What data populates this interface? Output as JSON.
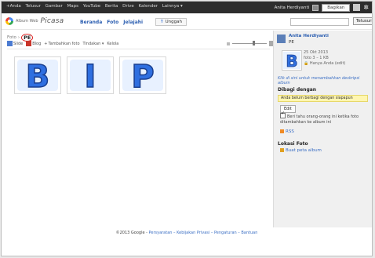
{
  "topbar": {
    "links": [
      "+Anda",
      "Telusur",
      "Gambar",
      "Maps",
      "YouTube",
      "Berita",
      "Drive",
      "Kalender",
      "Lainnya ▾"
    ],
    "user": "Anita Herdiyanti",
    "share_label": "Bagikan"
  },
  "header": {
    "logo_albums": "Album Web",
    "logo_picasa": "Picasa",
    "tabs": [
      "Beranda",
      "Foto",
      "Jelajahi"
    ],
    "upload_label": "Unggah",
    "search_button": "Telusuri"
  },
  "breadcrumb": {
    "root": "Foto",
    "separator": "›",
    "album": "PE"
  },
  "toolbar": {
    "slideshow": "Slide",
    "blog": "Blog",
    "add_photos": "Tambahkan foto",
    "actions": "Tindakan ▾",
    "sort": "Kelola"
  },
  "thumbnails": [
    "B",
    "I",
    "P"
  ],
  "panel": {
    "owner": "Anita Herdiyanti",
    "album": "PE",
    "date": "25 Okt 2013",
    "count": "foto 3 – 1 KB",
    "visibility": "Hanya Anda (edit)",
    "desc_link": "Klik di sini untuk menambahkan deskripsi album",
    "shared_heading": "Dibagi dengan",
    "shared_note": "Anda belum berbagi dengan siapapun",
    "edit_button": "Edit",
    "checkbox_text": "Beri tahu orang-orang ini ketika foto ditambahkan ke album ini",
    "rss": "RSS",
    "location_heading": "Lokasi Foto",
    "map_link": "Buat peta album"
  },
  "footer": {
    "copyright": "©2013 Google",
    "links": "Persyaratan – Kebijakan Privasi – Pengaturan – Bantuan"
  },
  "colors": {
    "topbar_bg": "#2d2d2d",
    "link_blue": "#2a5db0",
    "panel_bg": "#f0f0f0",
    "letter_blue": "#2f6fe0",
    "highlight_red": "#d22222"
  }
}
